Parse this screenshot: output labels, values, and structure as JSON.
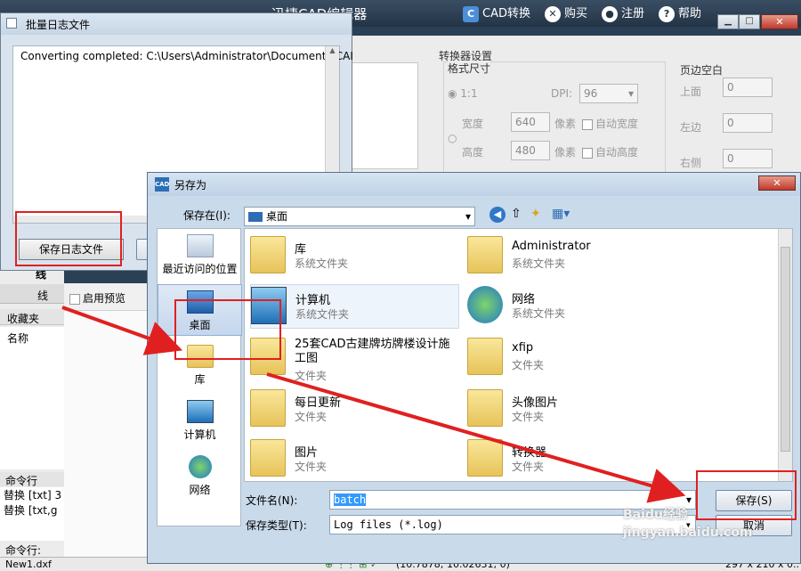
{
  "app": {
    "title": "迅捷CAD编辑器",
    "cad_convert": "CAD转换",
    "buy": "购买",
    "register": "注册",
    "help": "帮助"
  },
  "converter": {
    "section": "转换器设置",
    "format_size": "格式尺寸",
    "ratio": "1:1",
    "dpi_label": "DPI:",
    "dpi_value": "96",
    "width_label": "宽度",
    "width_value": "640",
    "height_label": "高度",
    "height_value": "480",
    "pixel": "像素",
    "auto_width": "自动宽度",
    "auto_height": "自动高度",
    "margin": "页边空白",
    "top": "上面",
    "left": "左边",
    "right": "右侧",
    "margin_value": "0"
  },
  "left_panel": {
    "line1": "线",
    "line2": "线",
    "preview": "启用预览",
    "favorites": "收藏夹",
    "name": "名称",
    "command_header": "命令行",
    "cmd1": "替换 [txt] 3",
    "cmd2": "替换 [txt,g",
    "cmd_prompt": "命令行:"
  },
  "statusbar": {
    "file": "New1.dxf",
    "coords": "(10.7878; 10.02631; 0)",
    "size": "297 x 210 x 0.."
  },
  "log_window": {
    "title": "批量日志文件",
    "text": "Converting completed: C:\\Users\\Administrator\\Documents\\CAI",
    "save_button": "保存日志文件"
  },
  "save_dialog": {
    "title": "另存为",
    "save_in_label": "保存在(I):",
    "location": "桌面",
    "places": [
      "最近访问的位置",
      "桌面",
      "库",
      "计算机",
      "网络"
    ],
    "items": [
      {
        "name": "库",
        "type": "系统文件夹"
      },
      {
        "name": "Administrator",
        "type": "系统文件夹"
      },
      {
        "name": "计算机",
        "type": "系统文件夹"
      },
      {
        "name": "网络",
        "type": "系统文件夹"
      },
      {
        "name": "25套CAD古建牌坊牌楼设计施工图",
        "type": "文件夹"
      },
      {
        "name": "xfip",
        "type": "文件夹"
      },
      {
        "name": "每日更新",
        "type": "文件夹"
      },
      {
        "name": "头像图片",
        "type": "文件夹"
      },
      {
        "name": "图片",
        "type": "文件夹"
      },
      {
        "name": "转换器",
        "type": "文件夹"
      }
    ],
    "filename_label": "文件名(N):",
    "filename_value": "batch",
    "filetype_label": "保存类型(T):",
    "filetype_value": "Log files (*.log)",
    "save_button": "保存(S)",
    "cancel_button": "取消"
  },
  "watermark": "Baidu经验 jingyan.baidu.com"
}
